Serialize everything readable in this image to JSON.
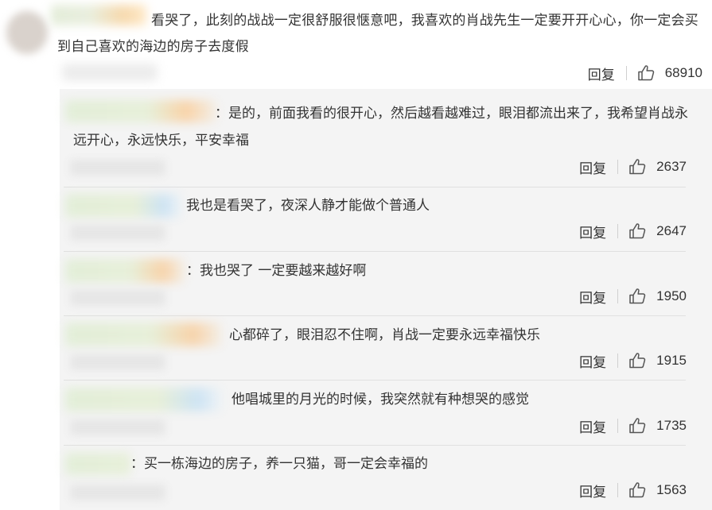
{
  "main_comment": {
    "text": "看哭了，此刻的战战一定很舒服很惬意吧，我喜欢的肖战先生一定要开开心心，你一定会买到自己喜欢的海边的房子去度假",
    "reply_label": "回复",
    "likes": "68910"
  },
  "replies": [
    {
      "text": "：是的，前面我看的很开心，然后越看越难过，眼泪都流出来了，我希望肖战永远开心，永远快乐，平安幸福",
      "reply_label": "回复",
      "likes": "2637"
    },
    {
      "text": "我也是看哭了，夜深人静才能做个普通人",
      "reply_label": "回复",
      "likes": "2647"
    },
    {
      "text": "：我也哭了 一定要越来越好啊",
      "reply_label": "回复",
      "likes": "1950"
    },
    {
      "text": "心都碎了，眼泪忍不住啊，肖战一定要永远幸福快乐",
      "reply_label": "回复",
      "likes": "1915"
    },
    {
      "text": "他唱城里的月光的时候，我突然就有种想哭的感觉",
      "reply_label": "回复",
      "likes": "1735"
    },
    {
      "text": "：买一栋海边的房子，养一只猫，哥一定会幸福的",
      "reply_label": "回复",
      "likes": "1563"
    }
  ],
  "colors": {
    "panel_bg": "#f4f4f4",
    "text": "#333333"
  },
  "icons": {
    "like": "thumbs-up-icon"
  }
}
